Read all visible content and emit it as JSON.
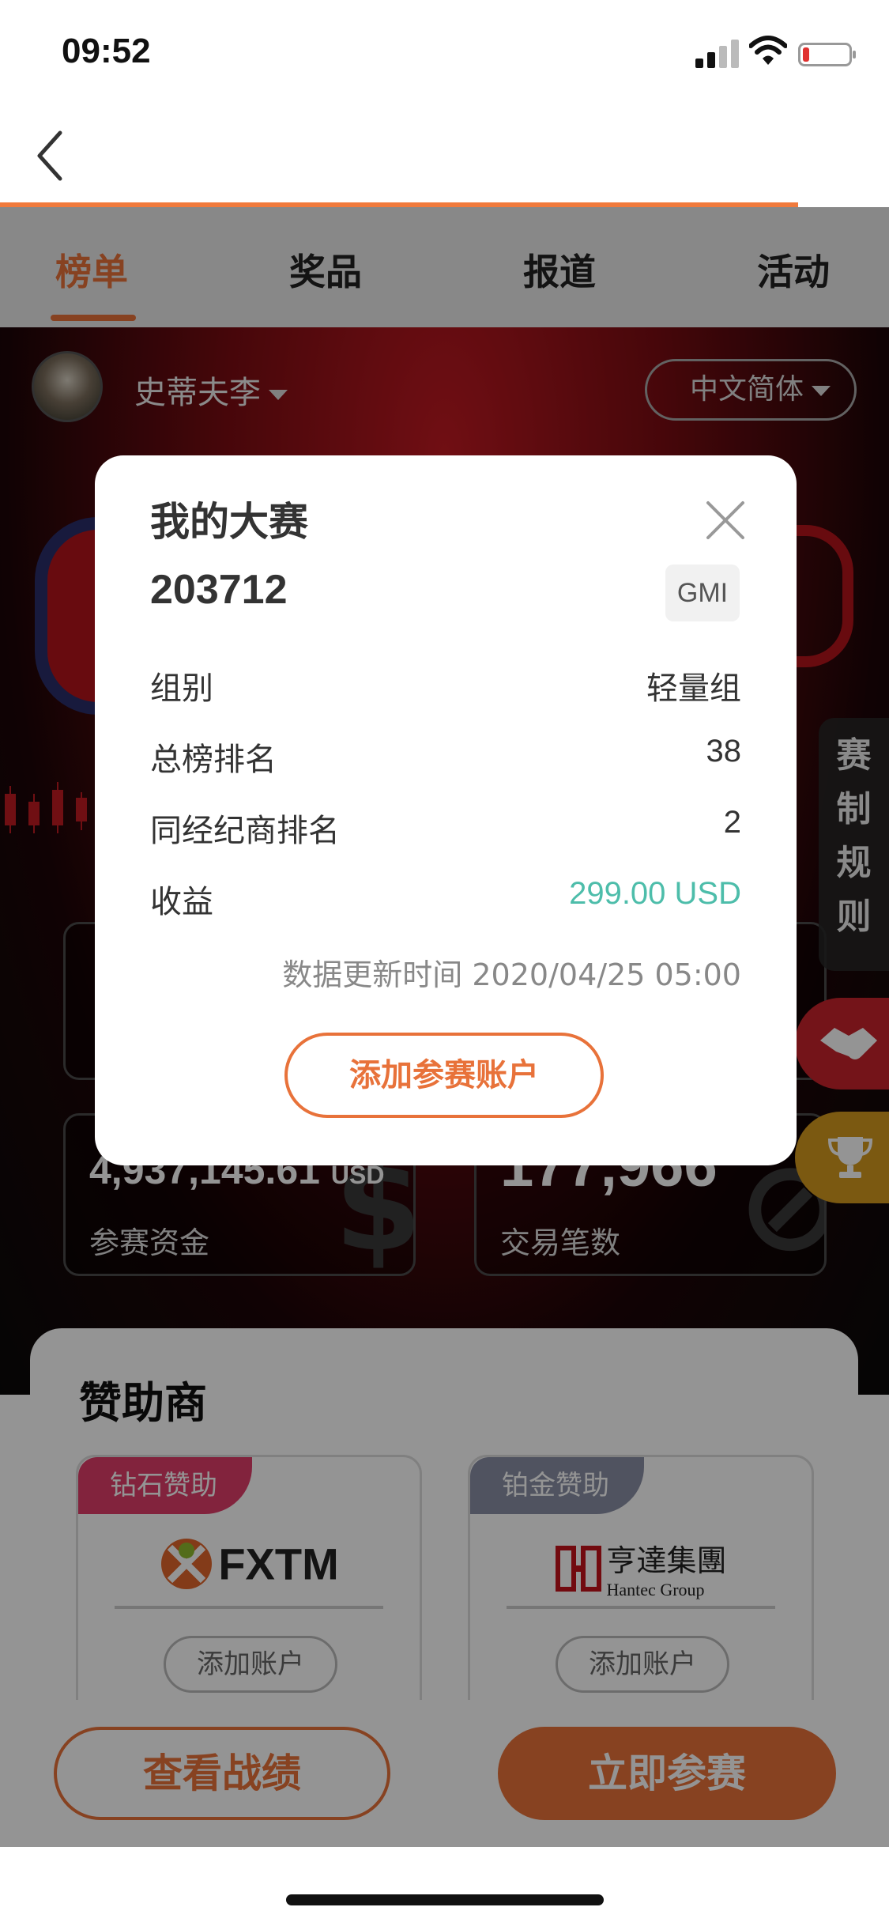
{
  "status_bar": {
    "time": "09:52"
  },
  "tabs": [
    {
      "label": "榜单",
      "active": true
    },
    {
      "label": "奖品",
      "active": false
    },
    {
      "label": "报道",
      "active": false
    },
    {
      "label": "活动",
      "active": false
    }
  ],
  "user": {
    "name": "史蒂夫李"
  },
  "language": {
    "label": "中文简体"
  },
  "stats": {
    "fund": {
      "value": "4,937,145.61",
      "unit": "USD",
      "label": "参赛资金"
    },
    "trades": {
      "value": "177,966",
      "label": "交易笔数"
    }
  },
  "side_panel": {
    "rules_label": "赛制规则"
  },
  "sponsors": {
    "title": "赞助商",
    "items": [
      {
        "tag": "钻石赞助",
        "tag_color": "#e03d6a",
        "logo": "FXTM",
        "add_label": "添加账户"
      },
      {
        "tag": "铂金赞助",
        "tag_color": "#8a8fa5",
        "logo_cn": "亨達集團",
        "logo_en": "Hantec Group",
        "add_label": "添加账户"
      }
    ]
  },
  "bottom": {
    "record_label": "查看战绩",
    "join_label": "立即参赛"
  },
  "modal": {
    "title": "我的大赛",
    "account_id": "203712",
    "broker": "GMI",
    "rows": [
      {
        "label": "组别",
        "value": "轻量组"
      },
      {
        "label": "总榜排名",
        "value": "38"
      },
      {
        "label": "同经纪商排名",
        "value": "2"
      },
      {
        "label": "收益",
        "value": "299.00 USD"
      }
    ],
    "updated": "数据更新时间 2020/04/25 05:00",
    "add_label": "添加参赛账户"
  },
  "colors": {
    "accent": "#e8723a",
    "profit": "#4dbdaa"
  }
}
